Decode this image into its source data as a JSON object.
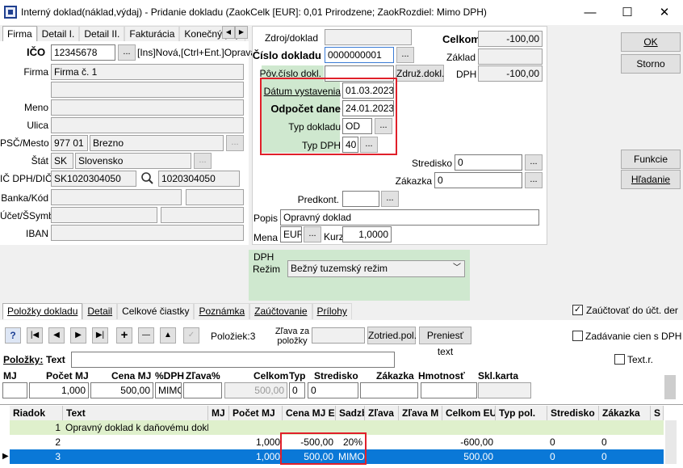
{
  "window": {
    "title": "Interný doklad(náklad,výdaj) - Pridanie dokladu  (ZaokCelk [EUR]: 0,01 Prirodzene; ZaokRozdiel: Mimo DPH)",
    "minimize": "—",
    "maximize": "☐",
    "close": "✕"
  },
  "left_tabs": [
    "Firma",
    "Detail I.",
    "Detail II.",
    "Fakturácia",
    "Konečný príj."
  ],
  "partner": {
    "ico_label": "IČO",
    "ico_value": "12345678",
    "ico_hint": "[Ins]Nová,[Ctrl+Ent.]Oprava",
    "firma_label": "Firma",
    "firma_value": "Firma č. 1",
    "meno_label": "Meno",
    "ulica_label": "Ulica",
    "psc_label": "PSČ/Mesto",
    "psc_value": "977 01",
    "mesto_value": "Brezno",
    "stat_label": "Štát",
    "stat_code": "SK",
    "stat_name": "Slovensko",
    "icdph_label": "IČ DPH/DIČ",
    "icdph_value": "SK1020304050",
    "dic_value": "1020304050",
    "banka_label": "Banka/Kód",
    "ucet_label": "Účet/ŠSymb",
    "iban_label": "IBAN"
  },
  "document": {
    "zdroj_label": "Zdroj/doklad",
    "cislo_label": "Číslo dokladu",
    "cislo_value": "0000000001",
    "povcislo_label": "Pôv.číslo dokl.",
    "zdruz_button": "Združ.dokl.",
    "datum_label": "Dátum vystavenia",
    "datum_value": "01.03.2023",
    "odpocet_label": "Odpočet dane",
    "odpocet_value": "24.01.2023",
    "typ_label": "Typ dokladu",
    "typ_value": "OD",
    "typdph_label": "Typ DPH",
    "typdph_value": "40",
    "stredisko_label": "Stredisko",
    "stredisko_value": "0",
    "zakazka_label": "Zákazka",
    "zakazka_value": "0",
    "predkont_label": "Predkont.",
    "popis_label": "Popis",
    "popis_value": "Opravný doklad",
    "mena_label": "Mena",
    "mena_value": "EUR",
    "kurz_label": "Kurz",
    "kurz_value": "1,0000"
  },
  "totals": {
    "celkom_label": "Celkom",
    "celkom_value": "-100,00",
    "zaklad_label": "Základ",
    "zaklad_value": "",
    "dph_label": "DPH",
    "dph_value": "-100,00"
  },
  "side_buttons": {
    "ok": "OK",
    "storno": "Storno",
    "funkcie": "Funkcie",
    "hladanie": "Hľadanie"
  },
  "dph_panel": {
    "title": "DPH",
    "rezim_label": "Režim",
    "rezim_value": "Bežný tuzemský režim"
  },
  "bottom_tabs": [
    "Položky dokladu",
    "Detail",
    "Celkové čiastky",
    "Poznámka",
    "Zaúčtovanie",
    "Prílohy"
  ],
  "zauctovat_label": "Zaúčtovať do účt. der",
  "zadavanie_label": "Zadávanie cien s DPH",
  "toolbar": {
    "help": "?",
    "first": "|◀",
    "prev": "◀",
    "next": "▶",
    "last": "▶|",
    "add": "+",
    "remove": "—",
    "up": "▲",
    "confirm": "✓",
    "poloziek_label": "Položiek:3",
    "zlava_label": "Zľava za položky",
    "zotried_button": "Zotried.pol.",
    "preniest_button": "Preniesť text"
  },
  "item_editor": {
    "polozky_label": "Položky:",
    "text_label": "Text",
    "textr_label": "Text.r.",
    "headers": [
      "MJ",
      "Počet MJ",
      "Cena MJ",
      "%DPH",
      "Zľava%",
      "Celkom",
      "Typ",
      "Stredisko",
      "Zákazka",
      "Hmotnosť",
      "Skl.karta"
    ],
    "pocet_value": "1,000",
    "cena_value": "500,00",
    "dph_value": "MIMO",
    "celkom_value": "500,00",
    "typ_value": "0",
    "stredisko_value": "0"
  },
  "grid": {
    "headers": [
      "Riadok",
      "Text",
      "MJ",
      "Počet MJ",
      "Cena MJ E",
      "Sadzb",
      "Zľava",
      "Zľava M",
      "Celkom EU",
      "Typ pol.",
      "Stredisko",
      "Zákazka",
      "S"
    ],
    "rows": [
      {
        "riadok": "1",
        "text": "Opravný doklad k daňovému dokladu",
        "pocet": "",
        "cena": "",
        "sadzba": "",
        "celkom": "",
        "stredisko": "",
        "zakazka": ""
      },
      {
        "riadok": "2",
        "text": "",
        "pocet": "1,000",
        "cena": "-500,00",
        "sadzba": "20%",
        "celkom": "-600,00",
        "stredisko": "0",
        "zakazka": "0"
      },
      {
        "riadok": "3",
        "text": "",
        "pocet": "1,000",
        "cena": "500,00",
        "sadzba": "MIMO",
        "celkom": "500,00",
        "stredisko": "0",
        "zakazka": "0"
      }
    ]
  }
}
